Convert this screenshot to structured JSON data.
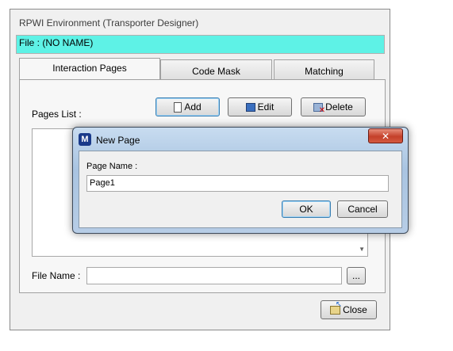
{
  "window": {
    "title": "RPWI Environment (Transporter Designer)"
  },
  "file_bar": {
    "text": "File : (NO NAME)"
  },
  "tabs": [
    {
      "label": "Interaction Pages"
    },
    {
      "label": "Code Mask"
    },
    {
      "label": "Matching"
    }
  ],
  "pages": {
    "list_label": "Pages List :",
    "add_label": "Add",
    "edit_label": "Edit",
    "delete_label": "Delete",
    "file_name_label": "File Name :",
    "file_name_value": "",
    "browse_label": "..."
  },
  "close_label": "Close",
  "dialog": {
    "icon_letter": "M",
    "title": "New Page",
    "close_glyph": "✕",
    "field_label": "Page Name :",
    "field_value": "Page1",
    "ok_label": "OK",
    "cancel_label": "Cancel"
  }
}
